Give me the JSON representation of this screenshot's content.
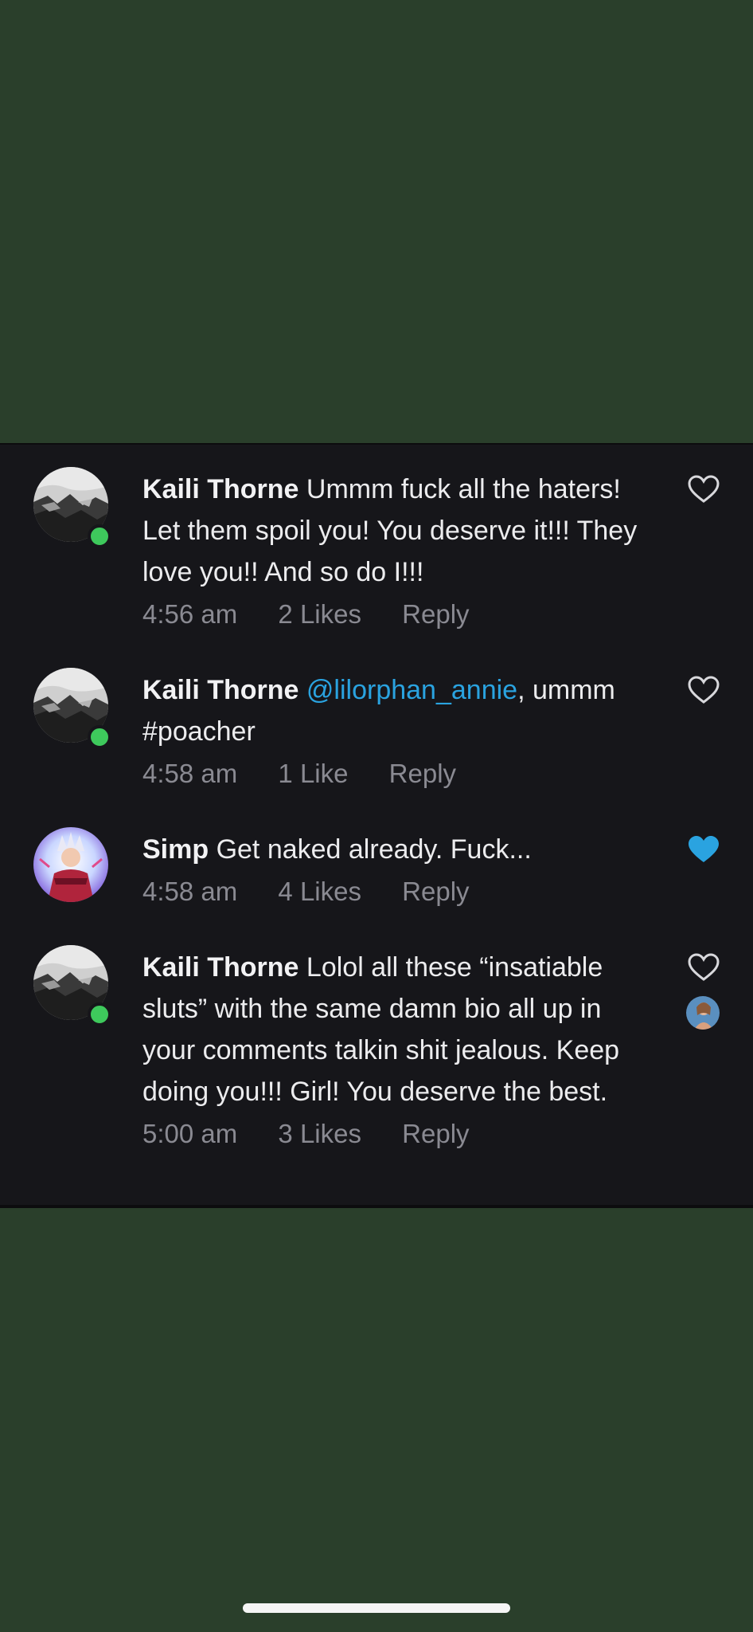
{
  "comments": [
    {
      "username": "Kaili Thorne",
      "text": " Ummm fuck all the haters! Let them spoil you! You deserve it!!! They love you!! And so do I!!!",
      "time": "4:56 am",
      "likes": "2 Likes",
      "reply": "Reply",
      "liked": false,
      "avatar_icon": "bw-landscape-avatar",
      "online": true
    },
    {
      "username": "Kaili Thorne",
      "mention": "@lilorphan_annie",
      "text": ", ummm #poacher",
      "time": "4:58 am",
      "likes": "1 Like",
      "reply": "Reply",
      "liked": false,
      "avatar_icon": "bw-landscape-avatar",
      "online": true
    },
    {
      "username": "Simp",
      "text": " Get naked already. Fuck...",
      "time": "4:58 am",
      "likes": "4 Likes",
      "reply": "Reply",
      "liked": true,
      "avatar_icon": "anime-character-avatar",
      "online": false
    },
    {
      "username": "Kaili Thorne",
      "text": " Lolol all these “insatiable sluts” with the same damn bio all up in your comments talkin shit jealous. Keep doing you!!! Girl! You deserve the best.",
      "time": "5:00 am",
      "likes": "3 Likes",
      "reply": "Reply",
      "liked": false,
      "avatar_icon": "bw-landscape-avatar",
      "online": true,
      "liked_by_creator": true
    }
  ],
  "colors": {
    "page_background": "#2a3f2b",
    "card_background": "#16161a",
    "mention": "#2aa3e0",
    "liked_heart": "#2aa3e0",
    "online": "#3ec95c",
    "meta_text": "#8a8a92"
  }
}
